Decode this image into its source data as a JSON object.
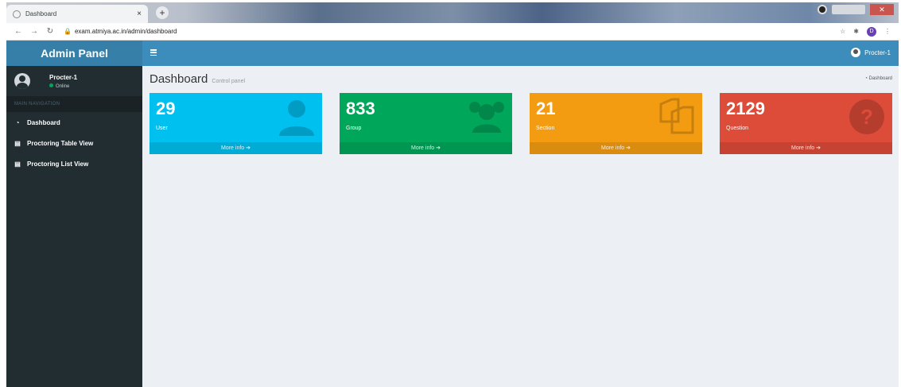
{
  "browser": {
    "tab_title": "Dashboard",
    "tab_close": "×",
    "new_tab": "+",
    "url": "exam.atmiya.ac.in/admin/dashboard",
    "profile_initial": "D"
  },
  "sidebar": {
    "logo": "Admin Panel",
    "user_name": "Procter-1",
    "user_status": "Online",
    "nav_header": "MAIN NAVIGATION",
    "items": [
      {
        "label": "Dashboard",
        "icon": "dashboard-icon"
      },
      {
        "label": "Proctoring Table View",
        "icon": "file-icon"
      },
      {
        "label": "Proctoring List View",
        "icon": "file-icon"
      }
    ]
  },
  "header": {
    "user_name": "Procter-1"
  },
  "content": {
    "title": "Dashboard",
    "subtitle": "Control panel",
    "breadcrumb": "Dashboard"
  },
  "boxes": [
    {
      "value": "29",
      "label": "User",
      "footer": "More info",
      "color": "#00c0ef",
      "icon": "user-icon"
    },
    {
      "value": "833",
      "label": "Group",
      "footer": "More info",
      "color": "#00a65a",
      "icon": "users-icon"
    },
    {
      "value": "21",
      "label": "Section",
      "footer": "More info",
      "color": "#f39c12",
      "icon": "copy-icon"
    },
    {
      "value": "2129",
      "label": "Question",
      "footer": "More info",
      "color": "#dd4b39",
      "icon": "question-icon"
    }
  ]
}
